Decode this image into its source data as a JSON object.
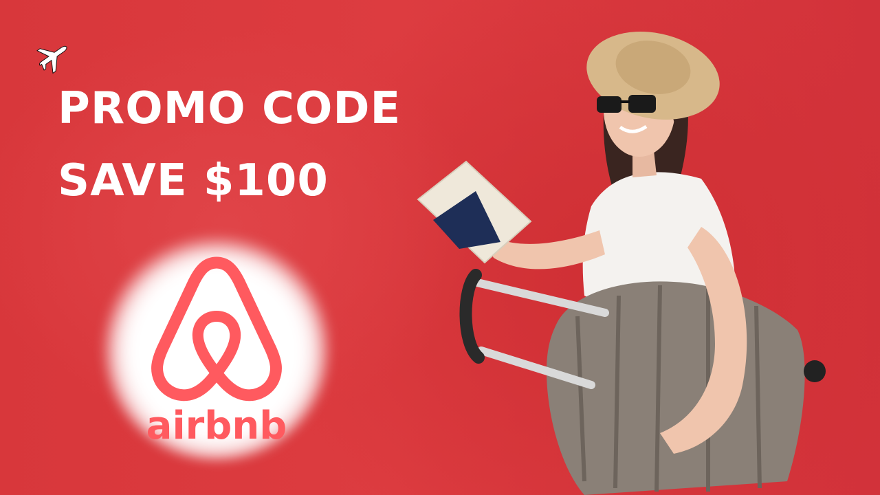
{
  "headline": {
    "line1": "PROMO CODE",
    "line2": "SAVE $100"
  },
  "logo": {
    "brand_name": "airbnb",
    "brand_color": "#ff5a5f"
  },
  "icons": {
    "plane": "airplane-icon"
  },
  "colors": {
    "background": "#d9363a",
    "text": "#ffffff"
  }
}
